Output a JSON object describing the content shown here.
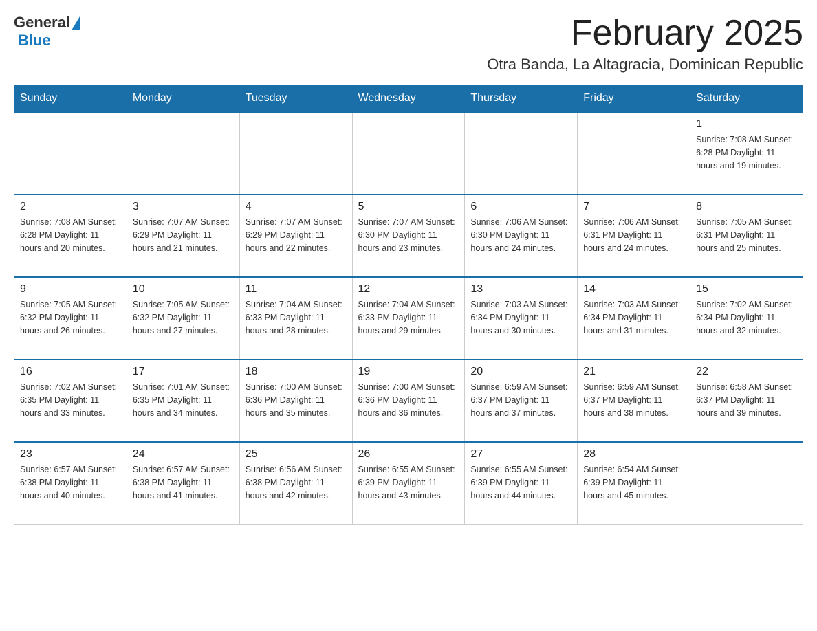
{
  "header": {
    "logo_general": "General",
    "logo_blue": "Blue",
    "month_title": "February 2025",
    "location": "Otra Banda, La Altagracia, Dominican Republic"
  },
  "days_of_week": [
    "Sunday",
    "Monday",
    "Tuesday",
    "Wednesday",
    "Thursday",
    "Friday",
    "Saturday"
  ],
  "weeks": [
    [
      {
        "day": "",
        "info": ""
      },
      {
        "day": "",
        "info": ""
      },
      {
        "day": "",
        "info": ""
      },
      {
        "day": "",
        "info": ""
      },
      {
        "day": "",
        "info": ""
      },
      {
        "day": "",
        "info": ""
      },
      {
        "day": "1",
        "info": "Sunrise: 7:08 AM\nSunset: 6:28 PM\nDaylight: 11 hours and 19 minutes."
      }
    ],
    [
      {
        "day": "2",
        "info": "Sunrise: 7:08 AM\nSunset: 6:28 PM\nDaylight: 11 hours and 20 minutes."
      },
      {
        "day": "3",
        "info": "Sunrise: 7:07 AM\nSunset: 6:29 PM\nDaylight: 11 hours and 21 minutes."
      },
      {
        "day": "4",
        "info": "Sunrise: 7:07 AM\nSunset: 6:29 PM\nDaylight: 11 hours and 22 minutes."
      },
      {
        "day": "5",
        "info": "Sunrise: 7:07 AM\nSunset: 6:30 PM\nDaylight: 11 hours and 23 minutes."
      },
      {
        "day": "6",
        "info": "Sunrise: 7:06 AM\nSunset: 6:30 PM\nDaylight: 11 hours and 24 minutes."
      },
      {
        "day": "7",
        "info": "Sunrise: 7:06 AM\nSunset: 6:31 PM\nDaylight: 11 hours and 24 minutes."
      },
      {
        "day": "8",
        "info": "Sunrise: 7:05 AM\nSunset: 6:31 PM\nDaylight: 11 hours and 25 minutes."
      }
    ],
    [
      {
        "day": "9",
        "info": "Sunrise: 7:05 AM\nSunset: 6:32 PM\nDaylight: 11 hours and 26 minutes."
      },
      {
        "day": "10",
        "info": "Sunrise: 7:05 AM\nSunset: 6:32 PM\nDaylight: 11 hours and 27 minutes."
      },
      {
        "day": "11",
        "info": "Sunrise: 7:04 AM\nSunset: 6:33 PM\nDaylight: 11 hours and 28 minutes."
      },
      {
        "day": "12",
        "info": "Sunrise: 7:04 AM\nSunset: 6:33 PM\nDaylight: 11 hours and 29 minutes."
      },
      {
        "day": "13",
        "info": "Sunrise: 7:03 AM\nSunset: 6:34 PM\nDaylight: 11 hours and 30 minutes."
      },
      {
        "day": "14",
        "info": "Sunrise: 7:03 AM\nSunset: 6:34 PM\nDaylight: 11 hours and 31 minutes."
      },
      {
        "day": "15",
        "info": "Sunrise: 7:02 AM\nSunset: 6:34 PM\nDaylight: 11 hours and 32 minutes."
      }
    ],
    [
      {
        "day": "16",
        "info": "Sunrise: 7:02 AM\nSunset: 6:35 PM\nDaylight: 11 hours and 33 minutes."
      },
      {
        "day": "17",
        "info": "Sunrise: 7:01 AM\nSunset: 6:35 PM\nDaylight: 11 hours and 34 minutes."
      },
      {
        "day": "18",
        "info": "Sunrise: 7:00 AM\nSunset: 6:36 PM\nDaylight: 11 hours and 35 minutes."
      },
      {
        "day": "19",
        "info": "Sunrise: 7:00 AM\nSunset: 6:36 PM\nDaylight: 11 hours and 36 minutes."
      },
      {
        "day": "20",
        "info": "Sunrise: 6:59 AM\nSunset: 6:37 PM\nDaylight: 11 hours and 37 minutes."
      },
      {
        "day": "21",
        "info": "Sunrise: 6:59 AM\nSunset: 6:37 PM\nDaylight: 11 hours and 38 minutes."
      },
      {
        "day": "22",
        "info": "Sunrise: 6:58 AM\nSunset: 6:37 PM\nDaylight: 11 hours and 39 minutes."
      }
    ],
    [
      {
        "day": "23",
        "info": "Sunrise: 6:57 AM\nSunset: 6:38 PM\nDaylight: 11 hours and 40 minutes."
      },
      {
        "day": "24",
        "info": "Sunrise: 6:57 AM\nSunset: 6:38 PM\nDaylight: 11 hours and 41 minutes."
      },
      {
        "day": "25",
        "info": "Sunrise: 6:56 AM\nSunset: 6:38 PM\nDaylight: 11 hours and 42 minutes."
      },
      {
        "day": "26",
        "info": "Sunrise: 6:55 AM\nSunset: 6:39 PM\nDaylight: 11 hours and 43 minutes."
      },
      {
        "day": "27",
        "info": "Sunrise: 6:55 AM\nSunset: 6:39 PM\nDaylight: 11 hours and 44 minutes."
      },
      {
        "day": "28",
        "info": "Sunrise: 6:54 AM\nSunset: 6:39 PM\nDaylight: 11 hours and 45 minutes."
      },
      {
        "day": "",
        "info": ""
      }
    ]
  ]
}
